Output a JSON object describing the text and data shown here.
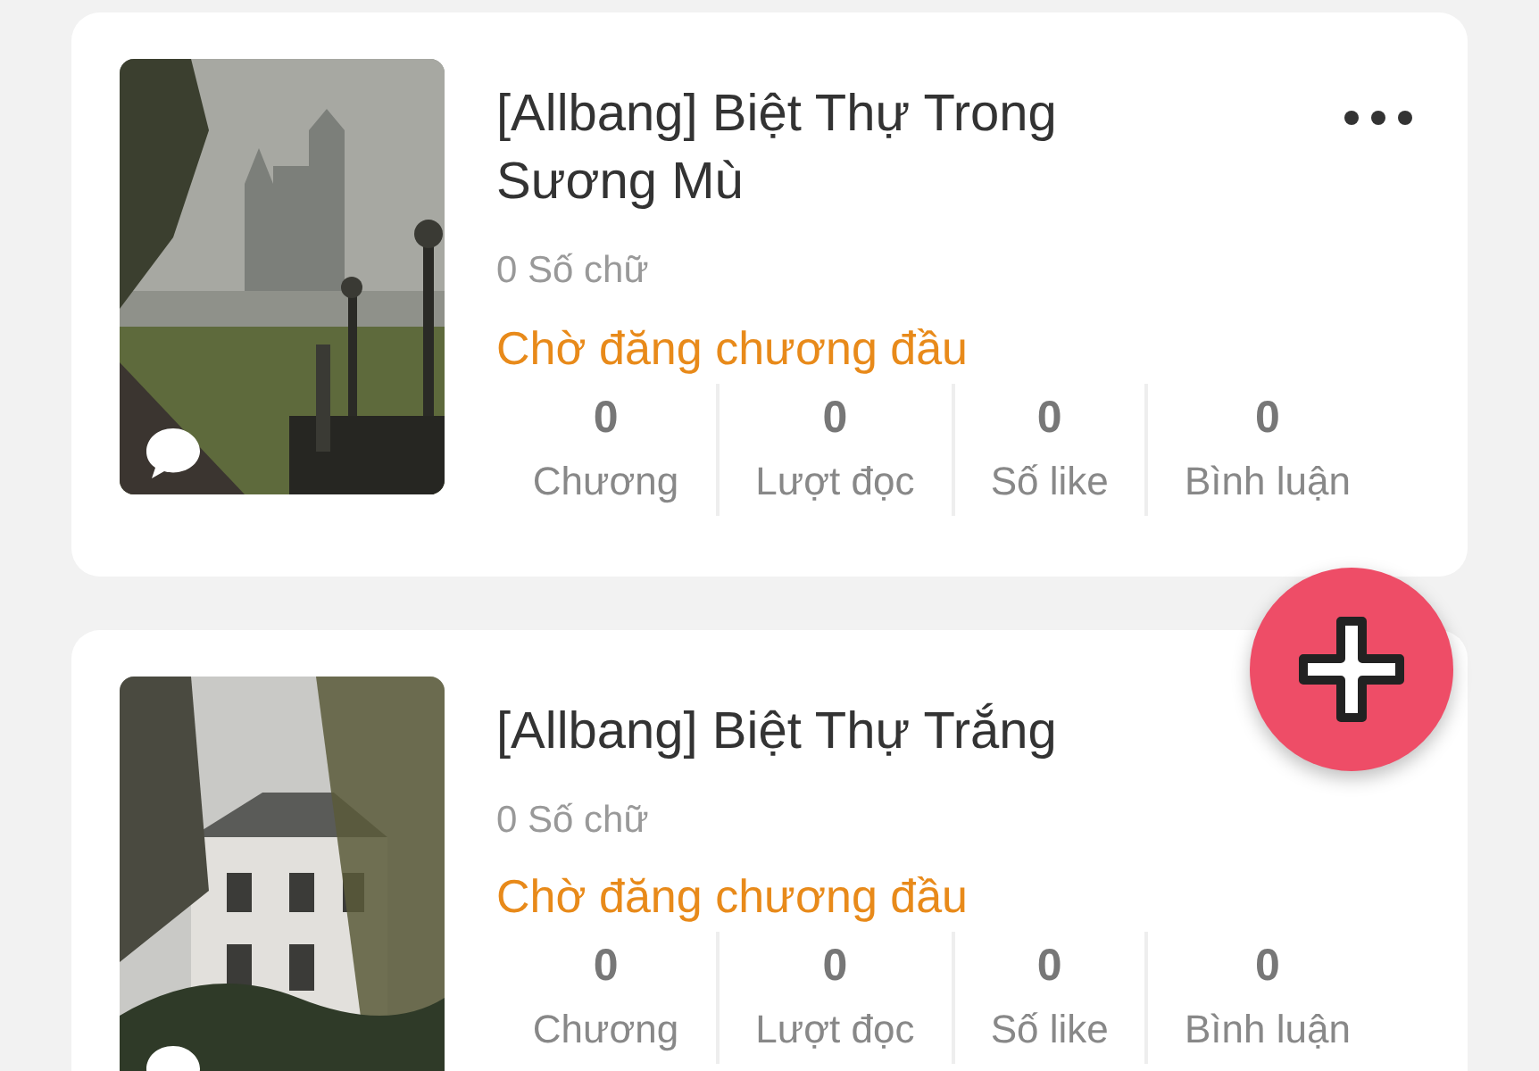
{
  "stories": [
    {
      "title": "[Allbang] Biệt Thự Trong Sương Mù",
      "word_count": "0 Số chữ",
      "status": "Chờ đăng chương đầu",
      "more_menu": true,
      "stats": [
        {
          "value": "0",
          "label": "Chương"
        },
        {
          "value": "0",
          "label": "Lượt đọc"
        },
        {
          "value": "0",
          "label": "Số like"
        },
        {
          "value": "0",
          "label": "Bình luận"
        }
      ]
    },
    {
      "title": "[Allbang] Biệt Thự Trắng",
      "word_count": "0 Số chữ",
      "status": "Chờ đăng chương đầu",
      "more_menu": false,
      "stats": [
        {
          "value": "0",
          "label": "Chương"
        },
        {
          "value": "0",
          "label": "Lượt đọc"
        },
        {
          "value": "0",
          "label": "Số like"
        },
        {
          "value": "0",
          "label": "Bình luận"
        }
      ]
    }
  ]
}
